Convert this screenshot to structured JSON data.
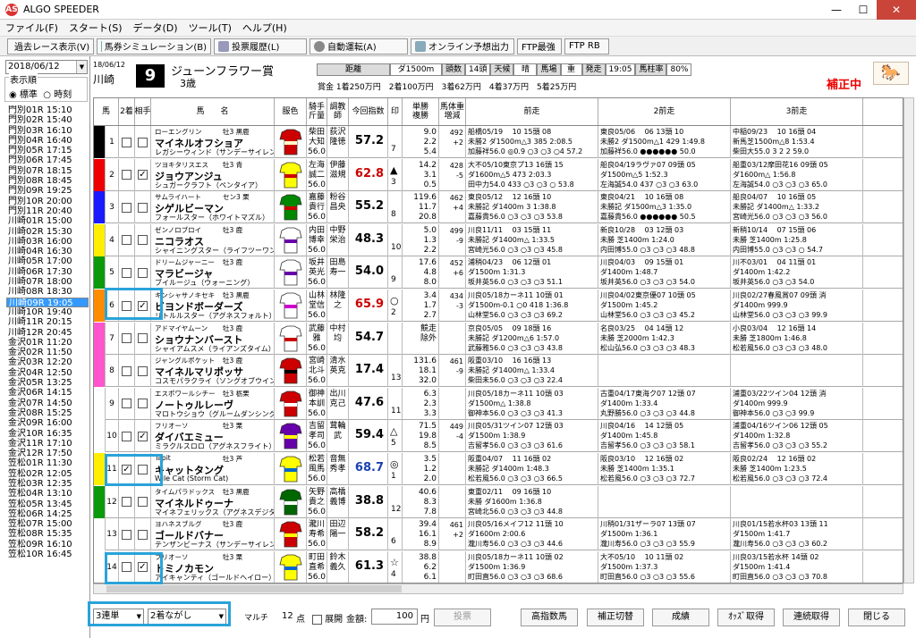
{
  "window": {
    "title": "ALGO SPEEDER",
    "logo": "AS"
  },
  "menu": [
    "ファイル(F)",
    "スタート(S)",
    "データ(D)",
    "ツール(T)",
    "ヘルプ(H)"
  ],
  "toolbar": [
    "過去レース表示(V)",
    "馬券シミュレーション(B)",
    "投票履歴(L)",
    "自動運転(A)",
    "オンライン予想出力",
    "FTP最強",
    "FTP RB"
  ],
  "left": {
    "date": "2018/06/12",
    "order_label": "表示順",
    "opt1": "標準",
    "opt2": "時刻",
    "races": [
      "門別01R 15:10",
      "門別02R 15:40",
      "門別03R 16:10",
      "門別04R 16:40",
      "門別05R 17:15",
      "門別06R 17:45",
      "門別07R 18:15",
      "門別08R 18:45",
      "門別09R 19:25",
      "門別10R 20:00",
      "門別11R 20:40",
      "川崎01R 15:00",
      "川崎02R 15:30",
      "川崎03R 16:00",
      "川崎04R 16:30",
      "川崎05R 17:00",
      "川崎06R 17:30",
      "川崎07R 18:00",
      "川崎08R 18:30",
      "川崎09R 19:05",
      "川崎10R 19:40",
      "川崎11R 20:15",
      "川崎12R 20:45",
      "金沢01R 11:20",
      "金沢02R 11:50",
      "金沢03R 12:20",
      "金沢04R 12:50",
      "金沢05R 13:25",
      "金沢06R 14:15",
      "金沢07R 14:50",
      "金沢08R 15:25",
      "金沢09R 16:00",
      "金沢10R 16:35",
      "金沢11R 17:10",
      "金沢12R 17:50",
      "笠松01R 11:30",
      "笠松02R 12:05",
      "笠松03R 12:35",
      "笠松04R 13:10",
      "笠松05R 13:45",
      "笠松06R 14:25",
      "笠松07R 15:00",
      "笠松08R 15:35",
      "笠松09R 16:10",
      "笠松10R 16:45"
    ],
    "selected": 19
  },
  "race": {
    "date": "18/06/12",
    "venue": "川崎",
    "no": "9",
    "name": "ジューンフラワー賞",
    "class": "3歳",
    "cond": [
      "距離",
      "ダ1500m",
      "頭数",
      "14頭",
      "天候",
      "晴",
      "馬場",
      "重",
      "発走",
      "19:05",
      "馬柱率",
      "80%"
    ],
    "prize": "賞金 1着250万円　2着100万円　3着62万円　4着37万円　5着25万円",
    "hosei": "補正中"
  },
  "headers": [
    "馬",
    "2着",
    "相手",
    "馬　　名",
    "服色",
    "騎手\n斤量",
    "調教\n師",
    "今回指数",
    "印",
    "単勝\n複勝",
    "馬体重\n増減",
    "前走",
    "2前走",
    "3前走"
  ],
  "horses": [
    {
      "waku": 1,
      "no": "1",
      "c2": false,
      "c3": false,
      "sire": "ローエングリン",
      "sex": "牡3 黒鹿",
      "name": "マイネルオフショア",
      "dam": "レガシーウィンド（サンデーサイレンス）",
      "jockey": "柴田\n大知\n56.0",
      "trainer": "荻沢\n隆徳",
      "idx": "57.2",
      "idxColor": "#000",
      "mark": "",
      "mn": "7",
      "odds": "9.0\n2.2\n5.4",
      "bw": "492\n+2",
      "p1": "船橋05/19　 10 15頭 08\n未勝2 ダ1500m△3 385 2:08.5\n加藤祥56.0 ◎0.9 ○3 ○3 ○4 57.2",
      "p2": "東良05/06　 06 13頭 10\n未勝2 ダ1500m△1 429 1:49.8\n加藤祥56.0 ●●●●●● 50.0",
      "p3": "中稲09/23　 10 16頭 04\n新馬芝1500m△8 1:53.4\n柴田大55.0 3 2 2 59.0"
    },
    {
      "waku": 2,
      "no": "2",
      "c2": false,
      "c3": true,
      "sire": "ツヨキタリスエス",
      "sex": "牡3 青",
      "name": "ジョウアンジュ",
      "dam": "シュガークラフト（ペンタイア）",
      "jockey": "左海\n誠二\n56.0",
      "trainer": "伊藤\n滋規",
      "idx": "62.8",
      "idxColor": "#c00",
      "mark": "▲",
      "mn": "3",
      "odds": "14.2\n3.1\n0.5",
      "bw": "428\n-5",
      "p1": "大不05/10東京プ13 16頭 15\nダ1600m△5 473 2:03.3\n田中力54.0 433 ○3 ○3 ○ 53.8",
      "p2": "船良04/19ラヴァ07 09頭 05\nダ1500m△5 1:52.3\n左海誠54.0 437 ○3 ○3 63.0",
      "p3": "船重03/12摩田花16 09頭 05\nダ1600m△ 1:56.8\n左海誠54.0 ○3 ○3 ○3 65.0"
    },
    {
      "waku": 3,
      "no": "3",
      "c2": false,
      "c3": false,
      "sire": "サムライハート",
      "sex": "セン3 栗",
      "name": "シゲルビーマン",
      "dam": "フォールスター（ホワイトマズル）",
      "jockey": "嘉藤\n貴行\n56.0",
      "trainer": "粉谷\n昌央",
      "idx": "55.2",
      "idxColor": "#000",
      "mark": "",
      "mn": "8",
      "odds": "119.6\n11.7\n20.8",
      "bw": "462\n+4",
      "p1": "東良05/12　 12 16頭 10\n未勝記 ダ1400m 3 1:38.8\n嘉藤貴56.0 ○3 ○3 ○3 53.8",
      "p2": "東良04/21　 10 16頭 08\n未勝記 ダ1500m△3 1:35.0\n嘉藤貴56.0 ●●●●●● 50.5",
      "p3": "船良04/07　 10 16頭 05\n未勝記 ダ1400m△ 1:33.2\n宮崎光56.0 ○3 ○3 ○3 56.0"
    },
    {
      "waku": 4,
      "no": "4",
      "c2": false,
      "c3": false,
      "sire": "ゼンノロブロイ",
      "sex": "牡3 鹿",
      "name": "ニコラオス",
      "dam": "シャイニングスター（ライフツーワン）",
      "jockey": "内田\n博幸\n56.0",
      "trainer": "中野\n栄治",
      "idx": "48.3",
      "idxColor": "#000",
      "mark": "",
      "mn": "10",
      "odds": "5.0\n1.3\n2.2",
      "bw": "499\n-9",
      "p1": "川良11/11　 03 15頭 11\n未勝記 ダ1400m△ 1:33.5\n宮崎光56.0 ○3 ○3 ○3 45.8",
      "p2": "新良10/28　 03 12頭 03\n未勝 芝1400m 1:24.0\n内田博55.0 ○3 ○3 ○3 48.8",
      "p3": "新稍10/14　 07 15頭 06\n未勝 芝1400m 1:25.8\n内田博55.0 ○3 ○3 ○ 54.7"
    },
    {
      "waku": 5,
      "no": "5",
      "c2": false,
      "c3": false,
      "sire": "ドリームジャーニー",
      "sex": "牡3 鹿",
      "name": "マラビージャ",
      "dam": "ブイルージュ（ウォーニング）",
      "jockey": "坂井\n英光\n56.0",
      "trainer": "田島\n寿一",
      "idx": "54.0",
      "idxColor": "#000",
      "mark": "",
      "mn": "9",
      "odds": "17.6\n4.8\n8.0",
      "bw": "452\n+6",
      "p1": "浦稍04/23　 06 12頭 01\nダ1500m 1:31.3\n坂井英56.0 ○3 ○3 ○3 51.1",
      "p2": "川良04/03　 09 15頭 01\nダ1400m 1:48.7\n坂井英56.0 ○3 ○3 ○3 54.0",
      "p3": "川不03/01　 04 11頭 01\nダ1400m 1:42.2\n坂井英56.0 ○3 ○3 54.0"
    },
    {
      "waku": 6,
      "no": "6",
      "c2": false,
      "c3": true,
      "sire": "キンシャサノキセキ",
      "sex": "牡3 黒鹿",
      "name": "ビヨンドボーダーズ",
      "dam": "リトルルスター（アグネスフォルト）",
      "jockey": "山林\n堂信\n56.0",
      "trainer": "林隆\n之",
      "idx": "65.9",
      "idxColor": "#c00",
      "mark": "○",
      "mn": "2",
      "odds": "3.4\n1.7\n2.7",
      "bw": "434\n-3",
      "p1": "川良05/18カーネ11 10頭 01\nダ1500m-0.1 ○0 418 1:36.8\n山林堂56.0 ○3 ○3 ○3 69.2",
      "p2": "川良04/02東京優07 10頭 05\nダ1500m 1:45.2\n山林堂56.0 ○3 ○3 ○3 45.2",
      "p3": "川良02/27春風賞07 09頭 消\nダ1400m 999.9\n山林堂56.0 ○3 ○3 ○3 99.9"
    },
    {
      "waku": 7,
      "no": "7",
      "c2": false,
      "c3": false,
      "sire": "アドマイヤムーン",
      "sex": "牡3 鹿",
      "name": "ショウナンバースト",
      "dam": "シャイアムスメ（ライアンズタイム）",
      "jockey": "武藤\n雅\n56.0",
      "trainer": "中村\n均",
      "idx": "54.7",
      "idxColor": "#000",
      "mark": "",
      "mn": "",
      "odds": "競走\n除外",
      "bw": "",
      "p1": "京良05/05　 09 18頭 16\n未勝記 ダ1200m△6 1:57.0\n武藤雅56.0 ○3 ○3 ○3 43.8",
      "p2": "名良03/25　 04 14頭 12\n未勝 芝2000m 1:42.3\n松山弘56.0 ○3 ○3 ○3 48.3",
      "p3": "小良03/04　 12 16頭 14\n未勝 芝1800m 1:46.8\n松若風56.0 ○3 ○3 ○3 48.0"
    },
    {
      "waku": 7,
      "no": "8",
      "c2": false,
      "c3": false,
      "sire": "ジャングルポケット",
      "sex": "牡3 鹿",
      "name": "マイネルマリポッサ",
      "dam": "コスモパラクライ（ソングオブウインド）",
      "jockey": "宮崎\n北斗\n56.0",
      "trainer": "清水\n英克",
      "idx": "17.4",
      "idxColor": "#000",
      "mark": "",
      "mn": "13",
      "odds": "131.6\n18.1\n32.0",
      "bw": "461\n-9",
      "p1": "阪重03/10　 16 16頭 13\n未勝記 ダ1400m△ 1:33.4\n柴田未56.0 ○3 ○3 ○3 22.4",
      "p2": "",
      "p3": ""
    },
    {
      "waku": 8,
      "no": "9",
      "c2": false,
      "c3": false,
      "sire": "エスポワールシチー",
      "sex": "牡3 栃栗",
      "name": "ノートゥルレーヴ",
      "dam": "マロトウショウ（グルームダンシング）",
      "jockey": "御神\n本訓\n56.0",
      "trainer": "出川\n克己",
      "idx": "47.6",
      "idxColor": "#000",
      "mark": "",
      "mn": "11",
      "odds": "6.3\n2.3\n3.3",
      "bw": "",
      "p1": "川良05/18カーネ11 10頭 03\nダ1500m△ 1:38.8\n御神本56.0 ○3 ○3 ○3 41.3",
      "p2": "古重04/17東海ク07 12頭 07\nダ1400m 1:33.4\n丸野勝56.0 ○3 ○3 ○3 44.8",
      "p3": "浦重03/22ツイン04 12頭 消\nダ1400m 999.9\n御神本56.0 ○3 ○3 99.9"
    },
    {
      "waku": 8,
      "no": "10",
      "c2": false,
      "c3": true,
      "sire": "フリオーソ",
      "sex": "牡3 栗",
      "name": "ダイバエミュー",
      "dam": "ミラクルスロロ（アグネスフライト）",
      "jockey": "吉留\n孝司\n56.0",
      "trainer": "茸輪\n武",
      "idx": "59.4",
      "idxColor": "#000",
      "mark": "△",
      "mn": "5",
      "odds": "71.5\n19.8\n8.5",
      "bw": "449\n-4",
      "p1": "川良05/31ツイン07 12頭 03\nダ1500m 1:38.9\n吉留孝56.0 ○3 ○3 ○3 61.6",
      "p2": "川良04/16　 14 12頭 05\nダ1400m 1:45.8\n吉留孝56.0 ○3 ○3 ○3 58.1",
      "p3": "浦重04/16ツイン06 12頭 05\nダ1400m 1:32.8\n吉留孝56.0 ○3 ○3 ○3 55.2"
    },
    {
      "waku": 9,
      "no": "11",
      "c2": true,
      "c3": false,
      "sire": "Tapit",
      "sex": "牡3 芦",
      "name": "キャットタング",
      "dam": "Wile Cat (Storm Cat)",
      "jockey": "松若\n風馬\n56.0",
      "trainer": "音無\n秀孝",
      "idx": "68.7",
      "idxColor": "#1a3fb0",
      "mark": "◎",
      "mn": "1",
      "odds": "3.5\n1.2\n2.0",
      "bw": "",
      "p1": "阪重04/07　 11 16頭 02\n未勝記 ダ1400m 1:48.3\n松若風56.0 ○3 ○3 ○3 66.5",
      "p2": "阪良03/10　 12 16頭 02\n未勝 芝1400m 1:35.1\n松若風56.0 ○3 ○3 ○3 72.7",
      "p3": "阪良02/24　 12 16頭 02\n未勝 芝1400m 1:23.5\n松若風56.0 ○3 ○3 ○3 72.4"
    },
    {
      "waku": 10,
      "no": "12",
      "c2": false,
      "c3": false,
      "sire": "タイムパラドックス",
      "sex": "牡3 黒鹿",
      "name": "マイネルドゥーナ",
      "dam": "マイネフェリックス（アグネスデジタル）",
      "jockey": "矢野\n貴之\n56.0",
      "trainer": "高橋\n義博",
      "idx": "38.8",
      "idxColor": "#000",
      "mark": "",
      "mn": "12",
      "odds": "40.6\n8.3\n7.8",
      "bw": "",
      "p1": "東重02/11　 09 16頭 10\n未勝 ダ1600m 1:36.8\n宮崎北56.0 ○3 ○3 ○3 44.8",
      "p2": "",
      "p3": ""
    },
    {
      "waku": 11,
      "no": "13",
      "c2": false,
      "c3": false,
      "sire": "ヨハネスブルグ",
      "sex": "牡3 鹿",
      "name": "ゴールドバナー",
      "dam": "テンザンビーナス（サンデーサイレンス）",
      "jockey": "瀧川\n寿希\n56.0",
      "trainer": "田辺\n陽一",
      "idx": "58.2",
      "idxColor": "#000",
      "mark": "",
      "mn": "6",
      "odds": "39.4\n16.1\n8.9",
      "bw": "461\n+2",
      "p1": "川良05/16メイフ12 11頭 10\nダ1600m 2:00.6\n瀧川寿56.0 ○3 ○3 ○3 44.6",
      "p2": "川稍01/31ザーラ07 13頭 07\nダ1500m 1:36.1\n瀧川寿56.0 ○3 ○3 ○3 55.9",
      "p3": "川良01/15若水杯03 13頭 11\nダ1500m 1:41.7\n瀧川寿56.0 ○3 ○3 ○3 60.2"
    },
    {
      "waku": 11,
      "no": "14",
      "c2": false,
      "c3": true,
      "sire": "フリオーソ",
      "sex": "牡3 栗",
      "name": "トミノカモン",
      "dam": "アイキャンティ（ゴールドヘイロー）",
      "jockey": "町田\n直希\n56.0",
      "trainer": "鈴木\n義久",
      "idx": "61.3",
      "idxColor": "#000",
      "mark": "☆",
      "mn": "4",
      "odds": "38.8\n6.2\n6.1",
      "bw": "",
      "p1": "川良05/18カーネ11 10頭 02\nダ1500m 1:36.9\n町田直56.0 ○3 ○3 ○3 68.6",
      "p2": "大不05/10　 10 11頭 02\nダ1500m 1:37.3\n町田直56.0 ○3 ○3 ○3 55.6",
      "p3": "川良03/15若水杯 14頭 02\nダ1500m 1:41.4\n町田直56.0 ○3 ○3 ○3 70.8"
    }
  ],
  "bottom": {
    "type": "3連単",
    "mode": "2着ながし",
    "label_multi": "マルチ",
    "points": "12",
    "points_unit": "点",
    "expand": "展開",
    "amount_label": "金額:",
    "amount": "100",
    "yen": "円",
    "vote": "投票",
    "btns": [
      "高指数馬",
      "補正切替",
      "成績",
      "ｵｯｽﾞ取得",
      "連続取得",
      "閉じる"
    ]
  },
  "wakuColors": [
    "#fff",
    "#000",
    "#e00",
    "#1a1aff",
    "#ffee00",
    "#0a9a0a",
    "#ff8c00",
    "#ff55cc",
    "#fff",
    "#ffee00",
    "#0a9a0a"
  ]
}
